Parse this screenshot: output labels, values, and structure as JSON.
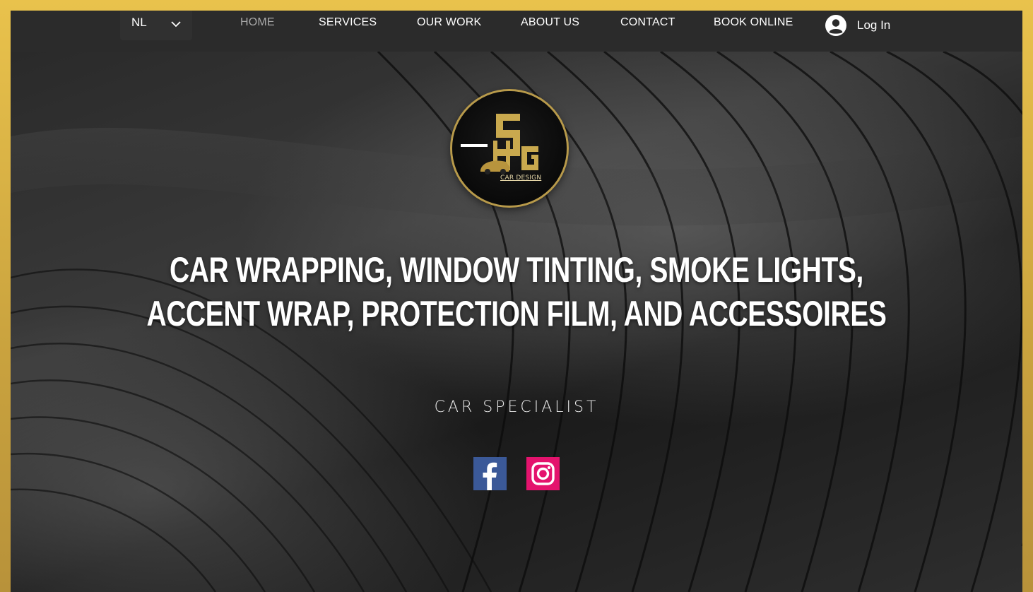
{
  "header": {
    "language": "NL",
    "nav": [
      {
        "label": "HOME",
        "active": true
      },
      {
        "label": "SERVICES",
        "active": false
      },
      {
        "label": "OUR WORK",
        "active": false
      },
      {
        "label": "ABOUT US",
        "active": false
      },
      {
        "label": "CONTACT",
        "active": false
      },
      {
        "label": "BOOK ONLINE",
        "active": false
      }
    ],
    "login_label": "Log In"
  },
  "hero": {
    "logo_text": "CAR DESIGN",
    "headline_line1": "CAR WRAPPING, WINDOW TINTING, SMOKE LIGHTS,",
    "headline_line2": "ACCENT WRAP, PROTECTION FILM, AND ACCESSOIRES",
    "subtitle": "CAR SPECIALIST"
  },
  "social": [
    {
      "icon": "facebook-icon",
      "color": "#3b5998"
    },
    {
      "icon": "instagram-icon",
      "color": "#e4136d"
    }
  ],
  "colors": {
    "accent_gold": "#e9c24c",
    "nav_bg": "#2b2b2b",
    "active_nav": "#a9a9a9"
  }
}
